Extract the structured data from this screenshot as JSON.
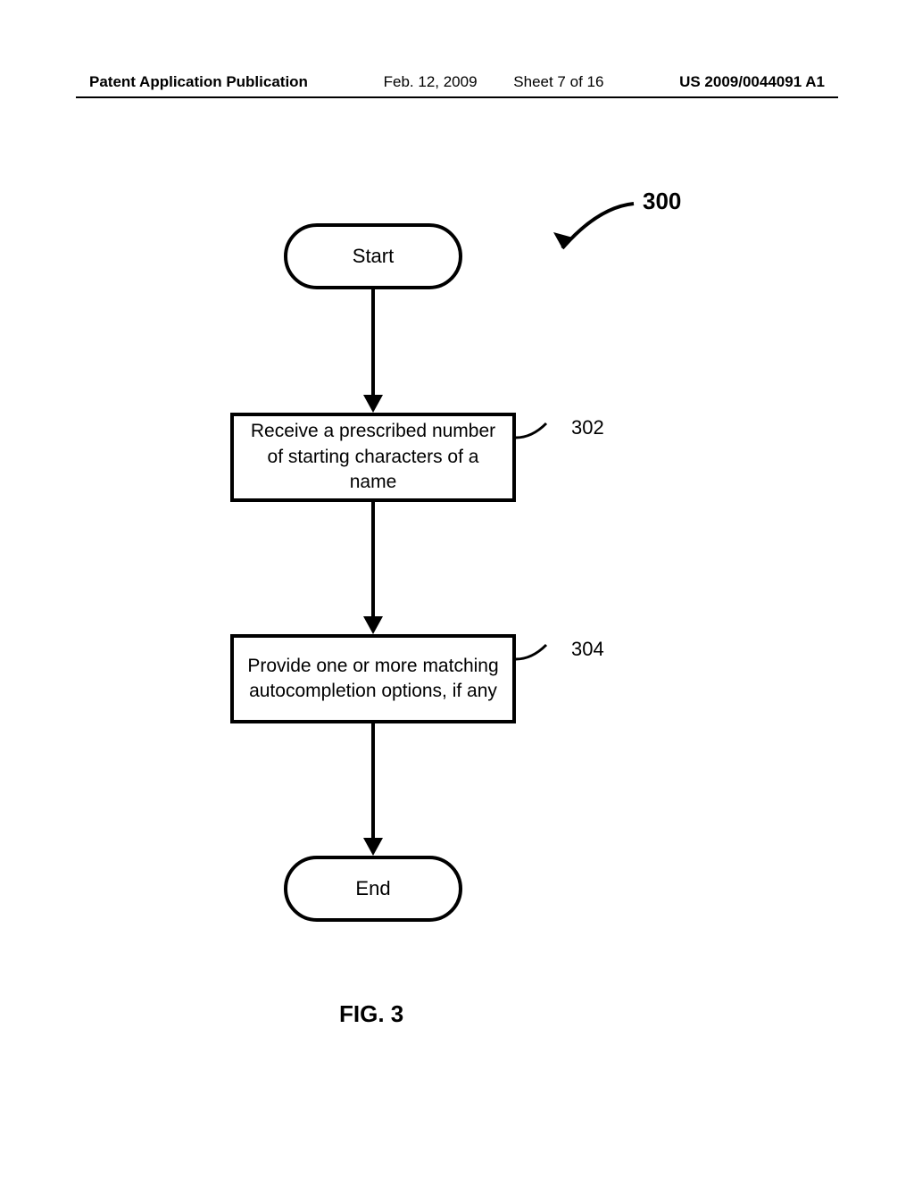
{
  "header": {
    "left": "Patent Application Publication",
    "date": "Feb. 12, 2009",
    "sheet": "Sheet 7 of 16",
    "right": "US 2009/0044091 A1"
  },
  "diagram": {
    "ref_number": "300",
    "start": "Start",
    "step1": {
      "text": "Receive a prescribed number of starting characters of a name",
      "ref": "302"
    },
    "step2": {
      "text": "Provide one or more matching autocompletion options, if any",
      "ref": "304"
    },
    "end": "End"
  },
  "figure_caption": "FIG. 3"
}
